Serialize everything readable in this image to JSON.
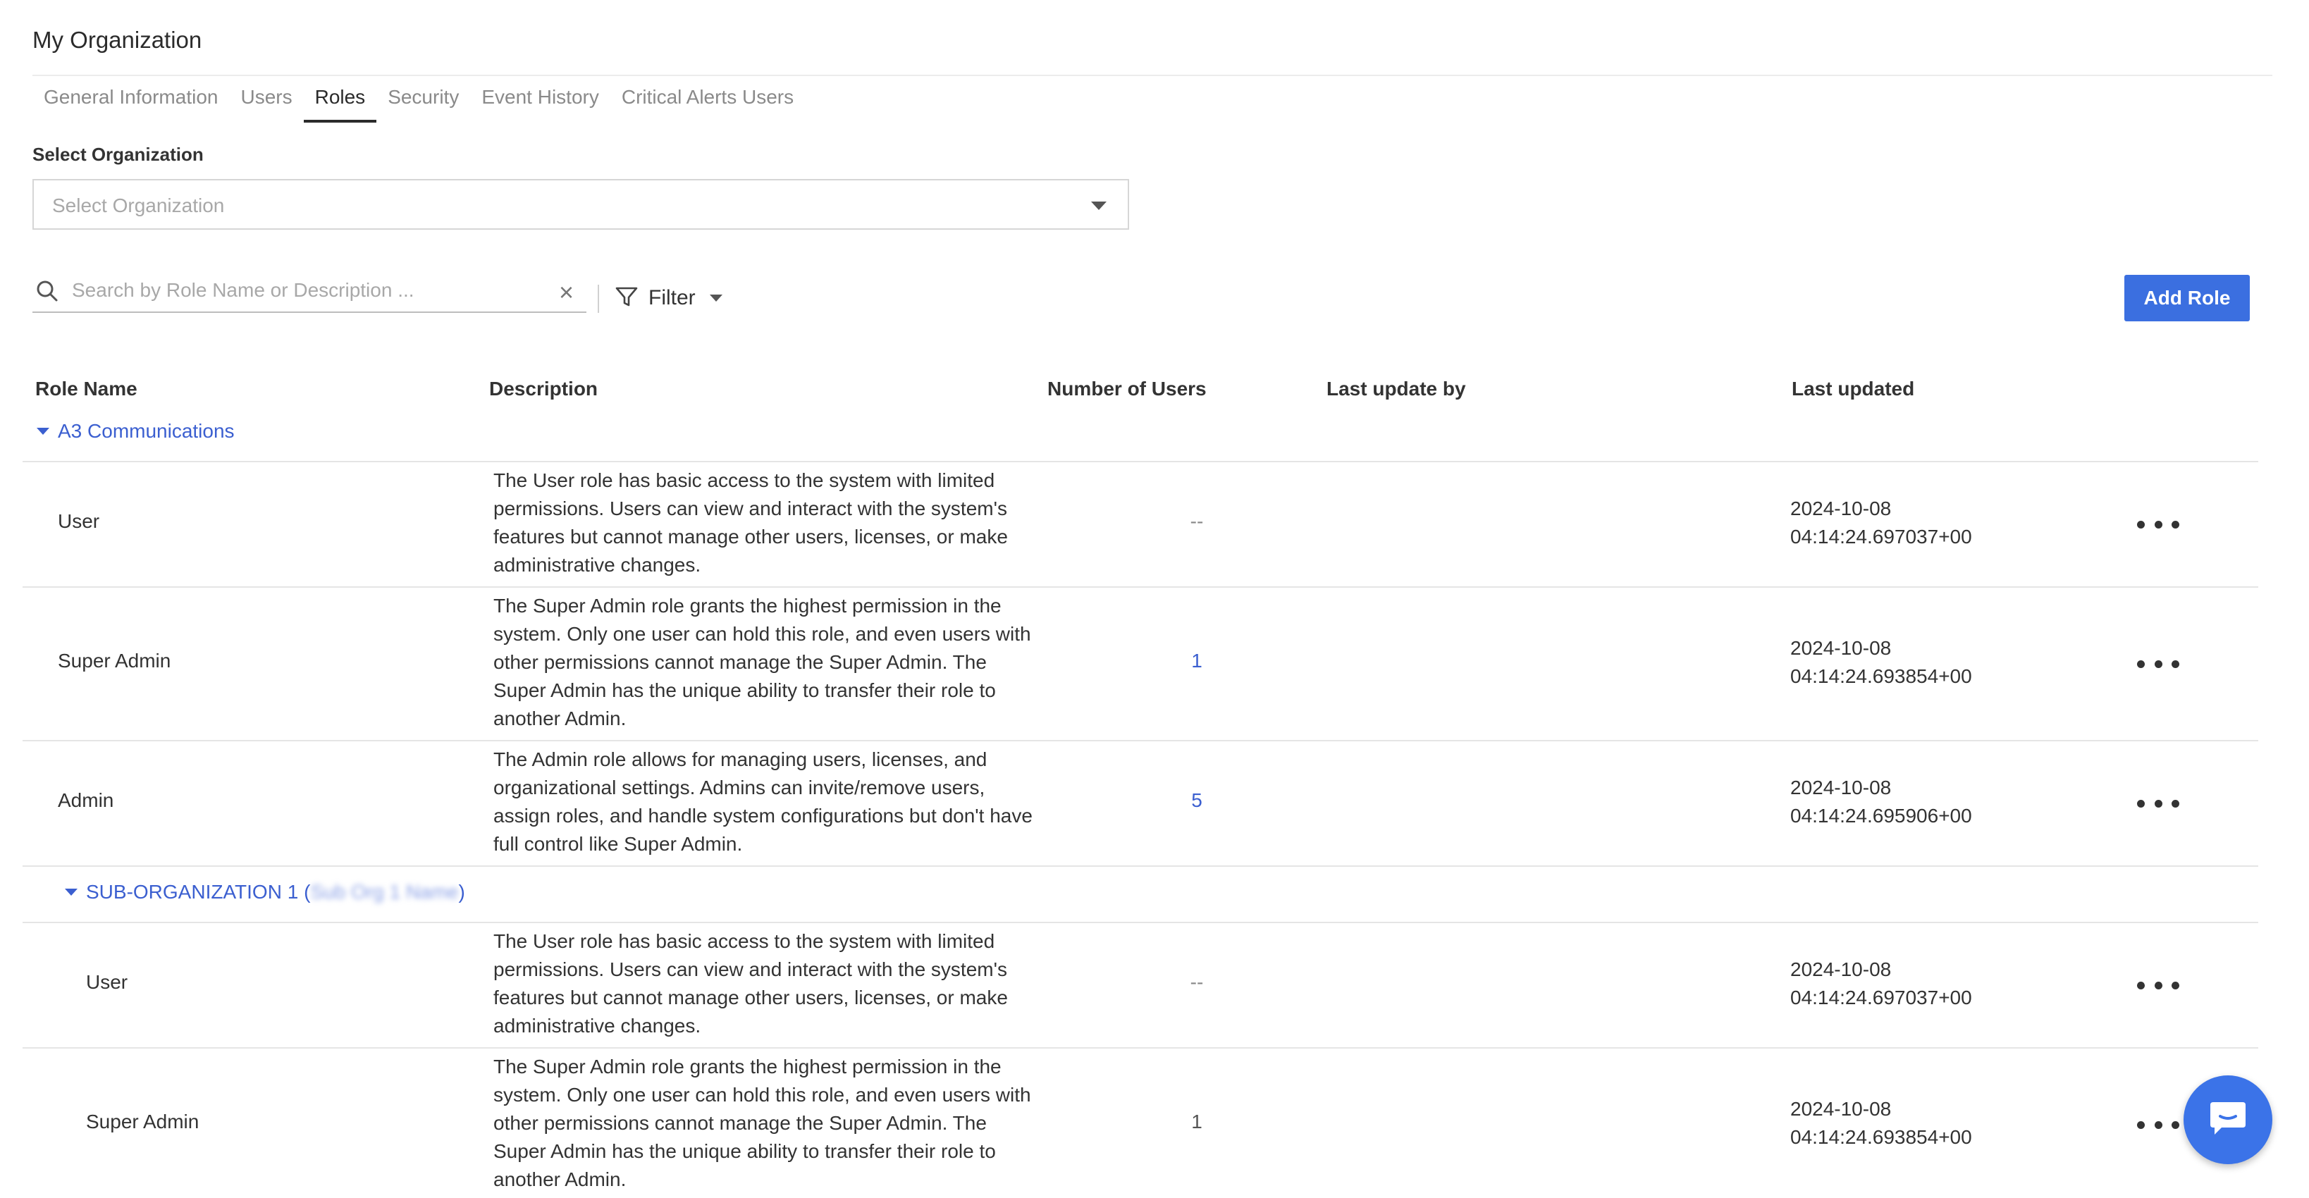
{
  "page": {
    "title": "My Organization"
  },
  "tabs": [
    {
      "label": "General Information"
    },
    {
      "label": "Users"
    },
    {
      "label": "Roles",
      "active": true
    },
    {
      "label": "Security"
    },
    {
      "label": "Event History"
    },
    {
      "label": "Critical Alerts Users"
    }
  ],
  "org_select": {
    "label": "Select Organization",
    "placeholder": "Select Organization"
  },
  "search": {
    "placeholder": "Search by Role Name or Description ...",
    "clear_icon": "close-icon"
  },
  "filter": {
    "label": "Filter"
  },
  "add_role": {
    "label": "Add Role"
  },
  "table": {
    "headers": {
      "role_name": "Role Name",
      "description": "Description",
      "num_users": "Number of Users",
      "last_update_by": "Last update by",
      "last_updated": "Last updated"
    },
    "groups": [
      {
        "name": "A3 Communications",
        "rows": [
          {
            "name": "User",
            "description": "The User role has basic access to the system with limited permissions. Users can view and interact with the system's features but cannot manage other users, licenses, or make administrative changes.",
            "num_users": "--",
            "last_update_by": "",
            "date": "2024-10-08",
            "time": "04:14:24.697037+00"
          },
          {
            "name": "Super Admin",
            "description": "The Super Admin role grants the highest permission in the system. Only one user can hold this role, and even users with other permissions cannot manage the Super Admin. The Super Admin has the unique ability to transfer their role to another Admin.",
            "num_users": "1",
            "last_update_by": "",
            "date": "2024-10-08",
            "time": "04:14:24.693854+00"
          },
          {
            "name": "Admin",
            "description": "The Admin role allows for managing users, licenses, and organizational settings. Admins can invite/remove users, assign roles, and handle system configurations but don't have full control like Super Admin.",
            "num_users": "5",
            "last_update_by": "",
            "date": "2024-10-08",
            "time": "04:14:24.695906+00"
          }
        ]
      },
      {
        "name": "SUB-ORGANIZATION 1",
        "name_suffix_open": " (",
        "name_blurred": "Sub Org 1 Name",
        "name_suffix_close": ")",
        "rows": [
          {
            "name": "User",
            "description": "The User role has basic access to the system with limited permissions. Users can view and interact with the system's features but cannot manage other users, licenses, or make administrative changes.",
            "num_users": "--",
            "last_update_by": "",
            "date": "2024-10-08",
            "time": "04:14:24.697037+00"
          },
          {
            "name": "Super Admin",
            "description": "The Super Admin role grants the highest permission in the system. Only one user can hold this role, and even users with other permissions cannot manage the Super Admin. The Super Admin has the unique ability to transfer their role to another Admin.",
            "num_users": "1",
            "last_update_by": "",
            "date": "2024-10-08",
            "time": "04:14:24.693854+00"
          }
        ]
      }
    ]
  },
  "colors": {
    "accent": "#3b6fe0",
    "link": "#3b5fd0",
    "chat": "#3b73e8"
  },
  "chat_widget": {
    "icon": "chat-bubble-icon"
  }
}
